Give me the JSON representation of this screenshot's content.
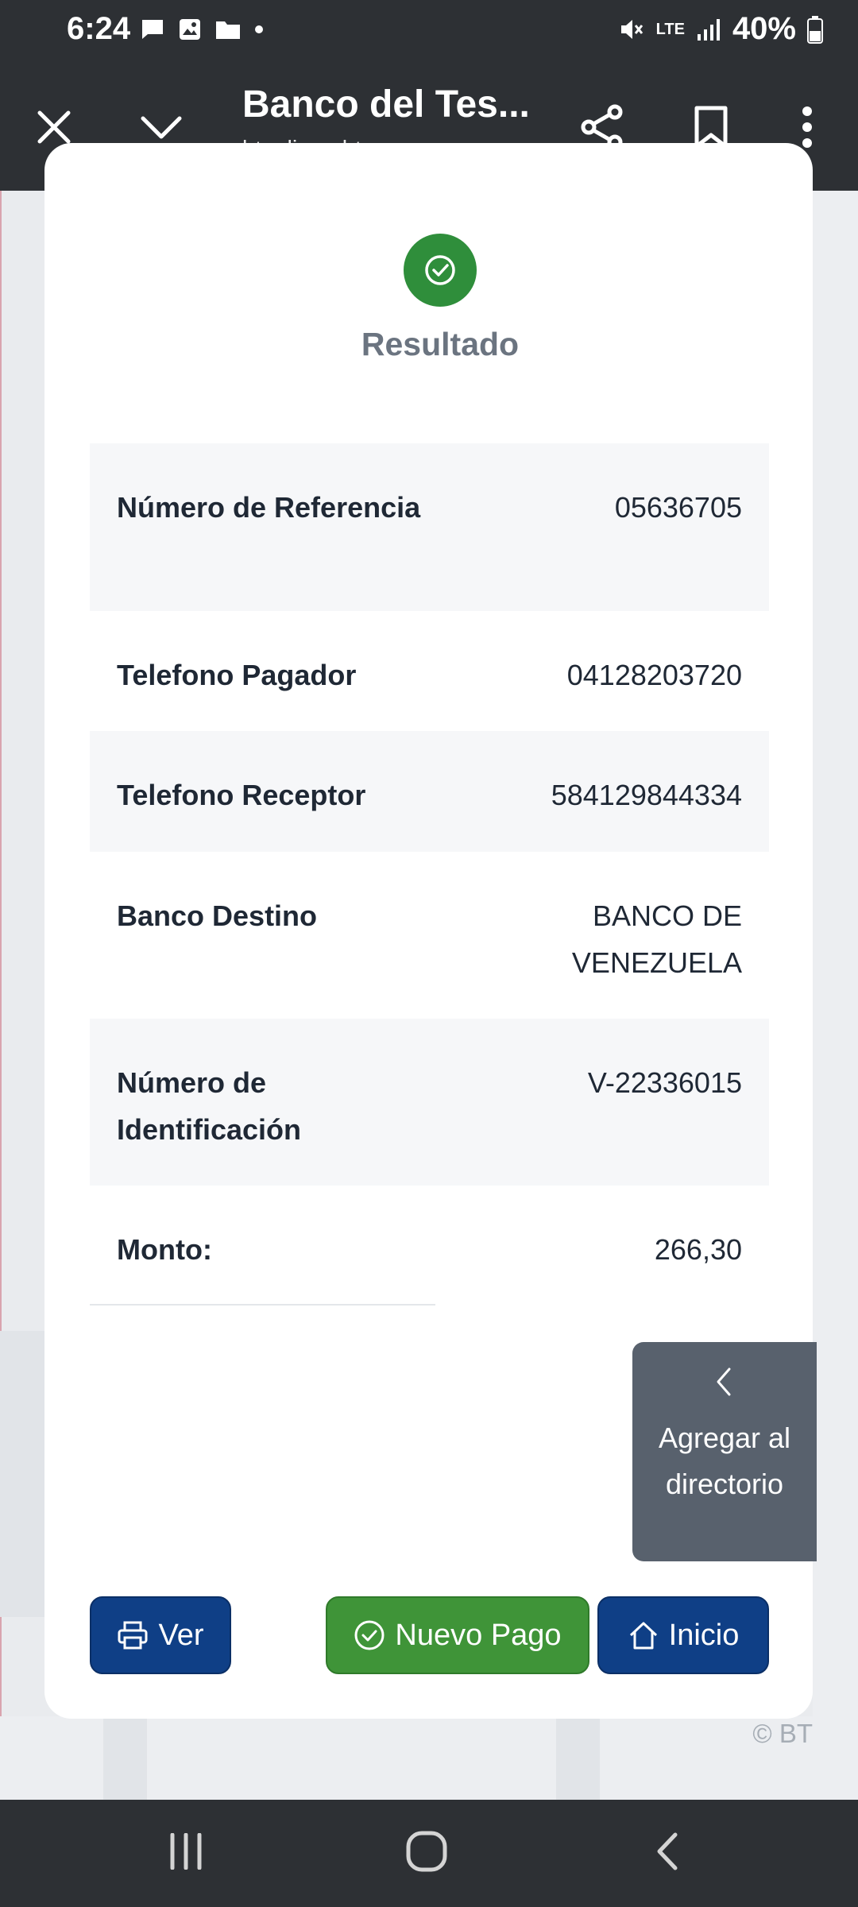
{
  "status_bar": {
    "time": "6:24",
    "battery": "40%",
    "network": "LTE"
  },
  "toolbar": {
    "title": "Banco del Tes...",
    "url": "btenlinea.bt.com.ve"
  },
  "result": {
    "title": "Resultado",
    "rows": [
      {
        "label": "Número de Referencia",
        "value": "05636705"
      },
      {
        "label": "Telefono Pagador",
        "value": "04128203720"
      },
      {
        "label": "Telefono Receptor",
        "value": "584129844334"
      },
      {
        "label": "Banco Destino",
        "value": "BANCO DE VENEZUELA"
      },
      {
        "label": "Número de Identificación",
        "value": "V-22336015"
      },
      {
        "label": "Monto:",
        "value": "266,30"
      }
    ]
  },
  "directory_button": {
    "label": "Agregar al directorio"
  },
  "actions": {
    "ver": "Ver",
    "nuevo_pago": "Nuevo Pago",
    "inicio": "Inicio"
  },
  "footer": {
    "copyright": "© BT"
  },
  "colors": {
    "success": "#2f8e3b",
    "primary": "#0f3f86",
    "green_button": "#3f9438",
    "directory_button": "#58616d"
  }
}
